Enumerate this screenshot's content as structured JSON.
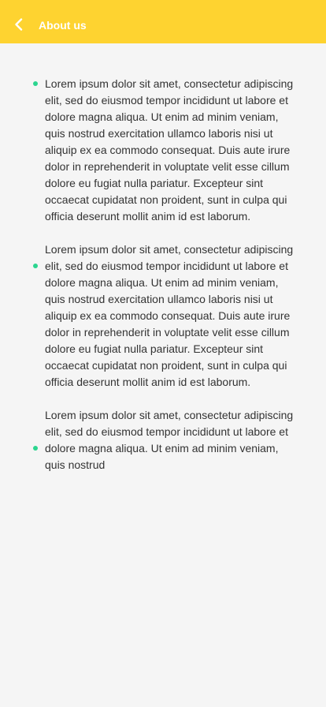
{
  "header": {
    "title": "About us",
    "back_icon": "chevron-left-icon",
    "background": "#fed330"
  },
  "content": {
    "bullet_color": "#2bd58f",
    "paragraphs": [
      "Lorem ipsum dolor sit amet, consectetur adipiscing elit, sed do eiusmod tempor incididunt ut labore et dolore magna aliqua. Ut enim ad minim veniam, quis nostrud exercitation ullamco laboris nisi ut aliquip ex ea commodo consequat. Duis aute irure dolor in reprehenderit in voluptate velit esse cillum dolore eu fugiat nulla pariatur. Excepteur sint occaecat cupidatat non proident, sunt in culpa qui officia deserunt mollit anim id est laborum.",
      "Lorem ipsum dolor sit amet, consectetur adipiscing elit, sed do eiusmod tempor incididunt ut labore et dolore magna aliqua. Ut enim ad minim veniam, quis nostrud exercitation ullamco laboris nisi ut aliquip ex ea commodo consequat. Duis aute irure dolor in reprehenderit in voluptate velit esse cillum dolore eu fugiat nulla pariatur. Excepteur sint occaecat cupidatat non proident, sunt in culpa qui officia deserunt mollit anim id est laborum.",
      "Lorem ipsum dolor sit amet, consectetur adipiscing elit, sed do eiusmod tempor incididunt ut labore et dolore magna aliqua. Ut enim ad minim veniam, quis nostrud"
    ]
  }
}
